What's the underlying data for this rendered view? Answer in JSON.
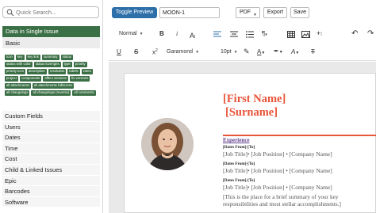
{
  "sidebar": {
    "search_placeholder": "Quick Search...",
    "section_header": "Data in Single Issue",
    "subsection": "Basic",
    "tags": [
      "icon",
      "key",
      "key link",
      "summary",
      "status",
      "status with color",
      "status lozenges",
      "type",
      "priority",
      "priority icon",
      "description",
      "resolution",
      "labels",
      "votes",
      "project",
      "components",
      "affect versions",
      "fix versions",
      "all attachments",
      "all attachments fullscreen",
      "all changelogs",
      "all changelogs (reverse)",
      "all comments"
    ],
    "categories": [
      "Custom Fields",
      "Users",
      "Dates",
      "Time",
      "Cost",
      "Child & Linked Issues",
      "Epic",
      "Barcodes",
      "Software"
    ]
  },
  "topbar": {
    "toggle_label": "Toggle Preview",
    "name_value": "MOON-1",
    "format_value": "PDF",
    "export_label": "Export",
    "save_label": "Save"
  },
  "toolbar": {
    "paragraph_style": "Normal",
    "font_family": "Garamond",
    "font_size": "10pt"
  },
  "document": {
    "first_name": "[First Name]",
    "surname": "[Surname]",
    "section_title": "Experience",
    "jobs": [
      {
        "dates": "[Dates From]-[To]",
        "title": "[Job Title]• [Job Position] • [Company Name]"
      },
      {
        "dates": "[Dates From]-[To]",
        "title": "[Job Title]• [Job Position] • [Company Name]"
      },
      {
        "dates": "[Dates From]-[To]",
        "title": "[Job Title]• [Job Position] • [Company Name]"
      }
    ],
    "summary": "[This is the place for a brief summary of your key responsibilities and most stellar accomplishments.]"
  },
  "colors": {
    "accent_green": "#3b6f45",
    "primary_blue": "#2d6fa8",
    "name_orange": "#e8553a",
    "experience_purple": "#5a3d8a"
  }
}
